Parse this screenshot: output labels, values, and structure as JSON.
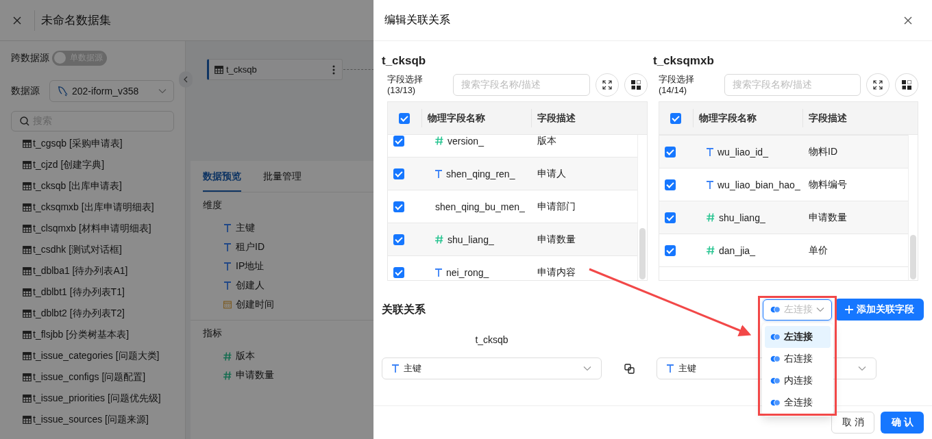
{
  "page": {
    "title": "未命名数据集",
    "cross_source": {
      "label": "跨数据源",
      "toggle_text": "单数据源",
      "on": false
    },
    "datasource": {
      "label": "数据源",
      "value": "202-iform_v358"
    },
    "search": {
      "placeholder": "搜索"
    },
    "tables": [
      "t_cgsqb [采购申请表]",
      "t_cjzd [创建字典]",
      "t_cksqb [出库申请表]",
      "t_cksqmxb [出库申请明细表]",
      "t_clsqmxb [材料申请明细表]",
      "t_csdhk [测试对话框]",
      "t_dblba1 [待办列表A1]",
      "t_dblbt1 [待办列表T1]",
      "t_dblbt2 [待办列表T2]",
      "t_flsjbb [分类树基本表]",
      "t_issue_categories [问题大类]",
      "t_issue_configs [问题配置]",
      "t_issue_priorities [问题优先级]",
      "t_issue_sources [问题来源]"
    ],
    "canvas_node": "t_cksqb",
    "tabs": [
      {
        "label": "数据预览",
        "selected": true
      },
      {
        "label": "批量管理",
        "selected": false
      }
    ],
    "dimensions": {
      "title": "维度",
      "items": [
        {
          "kind": "text",
          "label": "主键"
        },
        {
          "kind": "text",
          "label": "租户ID"
        },
        {
          "kind": "text",
          "label": "IP地址"
        },
        {
          "kind": "text",
          "label": "创建人"
        },
        {
          "kind": "date",
          "label": "创建时间"
        }
      ]
    },
    "measures": {
      "title": "指标",
      "items": [
        {
          "kind": "number",
          "label": "版本"
        },
        {
          "kind": "number",
          "label": "申请数量"
        }
      ]
    }
  },
  "dialog": {
    "title": "编辑关联关系",
    "panels": [
      {
        "table": "t_cksqb",
        "field_label": "字段选择",
        "count": "(13/13)",
        "placeholder": "搜索字段名称/描述",
        "columns": [
          "物理字段名称",
          "字段描述"
        ],
        "all_checked": true,
        "rows": [
          {
            "kind": "number",
            "name": "version_",
            "desc": "版本",
            "checked": true
          },
          {
            "kind": "text",
            "name": "shen_qing_ren_",
            "desc": "申请人",
            "checked": true
          },
          {
            "kind": "plain",
            "name": "shen_qing_bu_men_",
            "desc": "申请部门",
            "checked": true
          },
          {
            "kind": "number",
            "name": "shu_liang_",
            "desc": "申请数量",
            "checked": true
          },
          {
            "kind": "text",
            "name": "nei_rong_",
            "desc": "申请内容",
            "checked": true
          }
        ]
      },
      {
        "table": "t_cksqmxb",
        "field_label": "字段选择",
        "count": "(14/14)",
        "placeholder": "搜索字段名称/描述",
        "columns": [
          "物理字段名称",
          "字段描述"
        ],
        "all_checked": true,
        "rows": [
          {
            "kind": "text",
            "name": "wu_liao_id_",
            "desc": "物料ID",
            "checked": true
          },
          {
            "kind": "text",
            "name": "wu_liao_bian_hao_",
            "desc": "物料编号",
            "checked": true
          },
          {
            "kind": "number",
            "name": "shu_liang_",
            "desc": "申请数量",
            "checked": true
          },
          {
            "kind": "number",
            "name": "dan_jia_",
            "desc": "单价",
            "checked": true
          }
        ]
      }
    ],
    "relation": {
      "title": "关联关系",
      "join_placeholder": "左连接",
      "add_button": "添加关联字段",
      "left_table": "t_cksqb",
      "left_field": {
        "kind": "text",
        "value": "主键"
      },
      "right_field": {
        "kind": "text",
        "value": "主键"
      },
      "join_options": [
        {
          "label": "左连接",
          "selected": true
        },
        {
          "label": "右连接",
          "selected": false
        },
        {
          "label": "内连接",
          "selected": false
        },
        {
          "label": "全连接",
          "selected": false
        }
      ]
    },
    "buttons": {
      "cancel": "取消",
      "confirm": "确认"
    }
  }
}
